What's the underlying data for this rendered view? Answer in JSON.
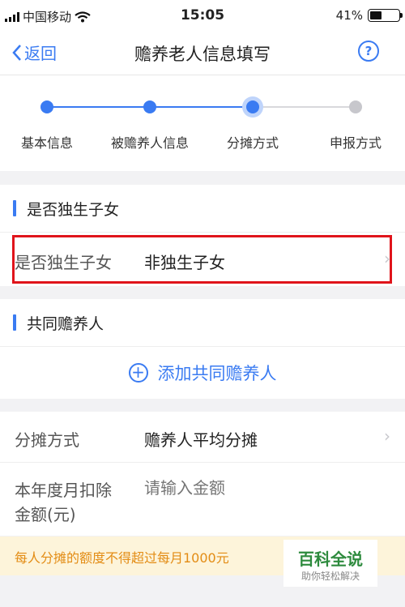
{
  "status_bar": {
    "carrier": "中国移动",
    "time": "15:05",
    "battery": "41%",
    "battery_level": 0.41
  },
  "nav": {
    "back_label": "返回",
    "title": "赡养老人信息填写",
    "help_symbol": "?"
  },
  "steps": [
    {
      "label": "基本信息",
      "state": "done"
    },
    {
      "label": "被赡养人信息",
      "state": "done"
    },
    {
      "label": "分摊方式",
      "state": "current"
    },
    {
      "label": "申报方式",
      "state": "todo"
    }
  ],
  "only_child_section": {
    "title": "是否独生子女",
    "row": {
      "label": "是否独生子女",
      "value": "非独生子女",
      "chevron": "›"
    }
  },
  "co_supporter_section": {
    "title": "共同赡养人",
    "add_button": {
      "icon": "+",
      "label": "添加共同赡养人"
    }
  },
  "split": {
    "method": {
      "label": "分摊方式",
      "value": "赡养人平均分摊",
      "chevron": "›"
    },
    "amount": {
      "label_line1": "本年度月扣除",
      "label_line2": "金额(元)",
      "placeholder": "请输入金额"
    }
  },
  "notice": "每人分摊的额度不得超过每月1000元",
  "watermark": {
    "title": "百科全说",
    "subtitle": "助你轻松解决"
  },
  "colors": {
    "accent": "#3a7bf2",
    "highlight": "#e0141b",
    "notice_text": "#e38c14",
    "notice_bg": "#fdf4da"
  }
}
